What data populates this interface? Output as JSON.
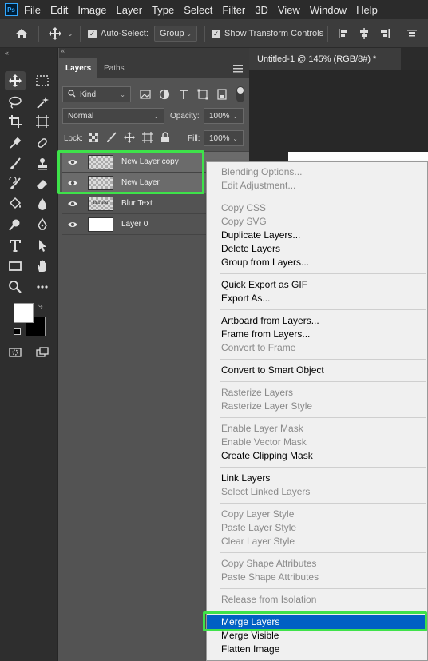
{
  "menubar": {
    "logo": "Ps",
    "items": [
      "File",
      "Edit",
      "Image",
      "Layer",
      "Type",
      "Select",
      "Filter",
      "3D",
      "View",
      "Window",
      "Help"
    ]
  },
  "options_bar": {
    "auto_select_label": "Auto-Select:",
    "auto_select_value": "Group",
    "show_transform_label": "Show Transform Controls"
  },
  "layers_panel": {
    "tabs": [
      "Layers",
      "Paths"
    ],
    "filter_kind": "Kind",
    "blend_mode": "Normal",
    "opacity_label": "Opacity:",
    "opacity_value": "100%",
    "lock_label": "Lock:",
    "fill_label": "Fill:",
    "fill_value": "100%",
    "layers": [
      {
        "name": "New Layer copy",
        "selected": true,
        "thumb": "checker"
      },
      {
        "name": "New Layer",
        "selected": true,
        "thumb": "checker"
      },
      {
        "name": "Blur Text",
        "selected": false,
        "thumb": "text",
        "thumb_text": "Blur Text"
      },
      {
        "name": "Layer 0",
        "selected": false,
        "thumb": "white"
      }
    ]
  },
  "document": {
    "tab_title": "Untitled-1 @ 145% (RGB/8#) *"
  },
  "context_menu": {
    "items": [
      {
        "label": "Blending Options...",
        "disabled": true
      },
      {
        "label": "Edit Adjustment...",
        "disabled": true
      },
      {
        "label": "Copy CSS",
        "disabled": true
      },
      {
        "label": "Copy SVG",
        "disabled": true
      },
      {
        "label": "Duplicate Layers...",
        "disabled": false
      },
      {
        "label": "Delete Layers",
        "disabled": false
      },
      {
        "label": "Group from Layers...",
        "disabled": false
      },
      {
        "label": "Quick Export as GIF",
        "disabled": false
      },
      {
        "label": "Export As...",
        "disabled": false
      },
      {
        "label": "Artboard from Layers...",
        "disabled": false
      },
      {
        "label": "Frame from Layers...",
        "disabled": false
      },
      {
        "label": "Convert to Frame",
        "disabled": true
      },
      {
        "label": "Convert to Smart Object",
        "disabled": false
      },
      {
        "label": "Rasterize Layers",
        "disabled": true
      },
      {
        "label": "Rasterize Layer Style",
        "disabled": true
      },
      {
        "label": "Enable Layer Mask",
        "disabled": true
      },
      {
        "label": "Enable Vector Mask",
        "disabled": true
      },
      {
        "label": "Create Clipping Mask",
        "disabled": false
      },
      {
        "label": "Link Layers",
        "disabled": false
      },
      {
        "label": "Select Linked Layers",
        "disabled": true
      },
      {
        "label": "Copy Layer Style",
        "disabled": true
      },
      {
        "label": "Paste Layer Style",
        "disabled": true
      },
      {
        "label": "Clear Layer Style",
        "disabled": true
      },
      {
        "label": "Copy Shape Attributes",
        "disabled": true
      },
      {
        "label": "Paste Shape Attributes",
        "disabled": true
      },
      {
        "label": "Release from Isolation",
        "disabled": true
      },
      {
        "label": "Merge Layers",
        "disabled": false,
        "highlighted": true
      },
      {
        "label": "Merge Visible",
        "disabled": false
      },
      {
        "label": "Flatten Image",
        "disabled": false
      }
    ]
  },
  "colors": {
    "highlight_green": "#3ee24a",
    "menu_highlight_blue": "#0060c4",
    "foreground": "#ffffff",
    "background": "#000000"
  }
}
